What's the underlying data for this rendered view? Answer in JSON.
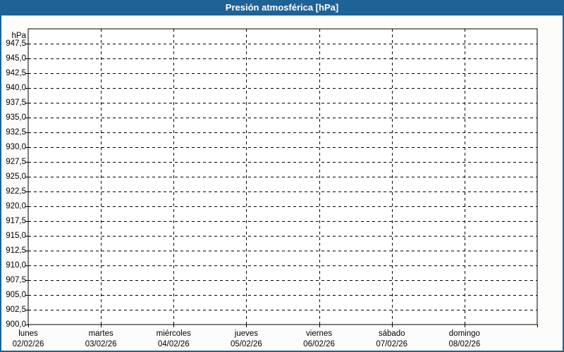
{
  "window": {
    "title": "Presión atmosférica [hPa]"
  },
  "chart_data": {
    "type": "line",
    "title": "Presión atmosférica [hPa]",
    "series": [],
    "grid": "dashed",
    "legend": "none",
    "y_axis": {
      "unit_label": "hPa",
      "min": 900,
      "max": 950,
      "tick_step": 2.5,
      "tick_values": [
        947.5,
        945.0,
        942.5,
        940.0,
        937.5,
        935.0,
        932.5,
        930.0,
        927.5,
        925.0,
        922.5,
        920.0,
        917.5,
        915.0,
        912.5,
        910.0,
        907.5,
        905.0,
        902.5,
        900.0
      ],
      "tick_labels": [
        "947,5",
        "945,0",
        "942,5",
        "940,0",
        "937,5",
        "935,0",
        "932,5",
        "930,0",
        "927,5",
        "925,0",
        "922,5",
        "920,0",
        "917,5",
        "915,0",
        "912,5",
        "910,0",
        "907,5",
        "905,0",
        "902,5",
        "900,0"
      ]
    },
    "x_axis": {
      "days": [
        {
          "name": "lunes",
          "date": "02/02/26"
        },
        {
          "name": "martes",
          "date": "03/02/26"
        },
        {
          "name": "miércoles",
          "date": "04/02/26"
        },
        {
          "name": "jueves",
          "date": "05/02/26"
        },
        {
          "name": "viernes",
          "date": "06/02/26"
        },
        {
          "name": "sábado",
          "date": "07/02/26"
        },
        {
          "name": "domingo",
          "date": "08/02/26"
        }
      ]
    }
  },
  "colors": {
    "accent_blue": "#1f6296",
    "title_text": "#ffffff",
    "grid_line": "#000000",
    "plot_background": "#ffffff",
    "page_background": "#fcfdfb"
  }
}
